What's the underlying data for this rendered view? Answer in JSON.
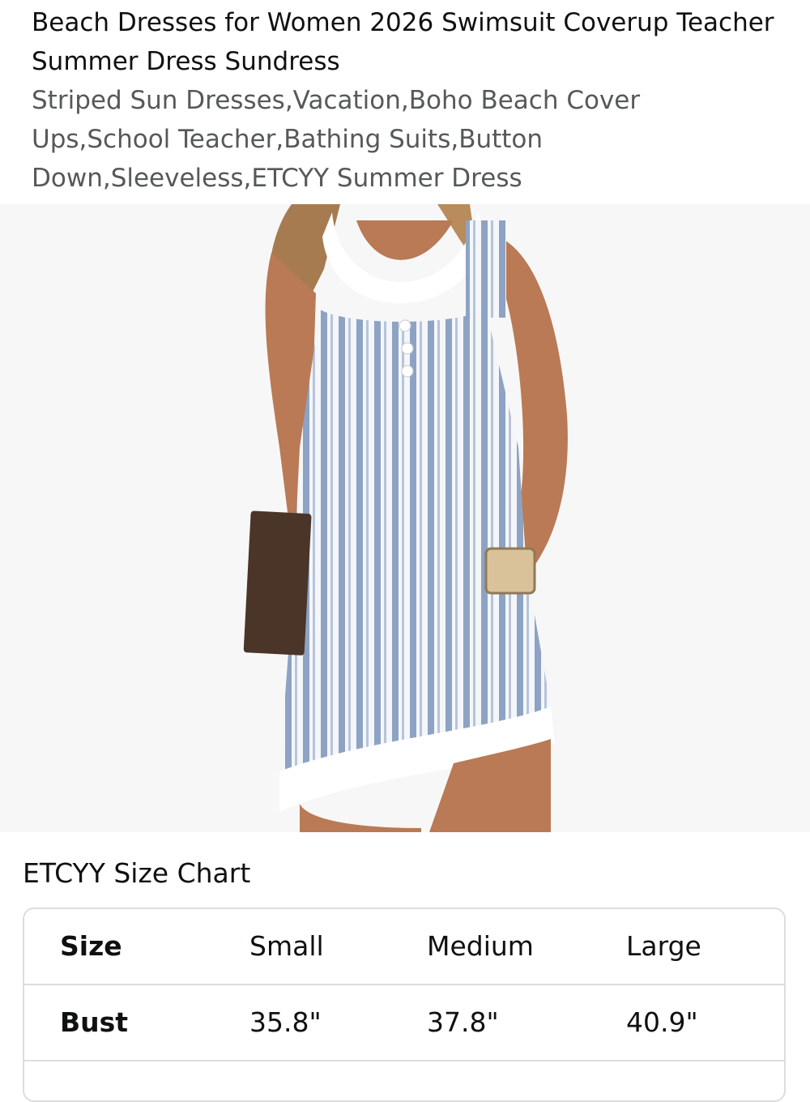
{
  "product": {
    "title": "Beach Dresses for Women 2026 Swimsuit Coverup Teacher Summer Dress Sundress",
    "subtitle": "Striped Sun Dresses,Vacation,Boho Beach Cover Ups,School Teacher,Bathing Suits,Button Down,Sleeveless,ETCYY Summer Dress"
  },
  "image": {
    "description_icon": "product-photo"
  },
  "size_chart": {
    "heading": "ETCYY Size Chart",
    "columns": [
      "Size",
      "Small",
      "Medium",
      "Large"
    ],
    "rows": [
      {
        "label": "Bust",
        "values": [
          "35.8\"",
          "37.8\"",
          "40.9\""
        ]
      }
    ]
  },
  "colors": {
    "stripe": "#8ea3c4",
    "border": "#dddddd",
    "subtitle": "#565959"
  }
}
